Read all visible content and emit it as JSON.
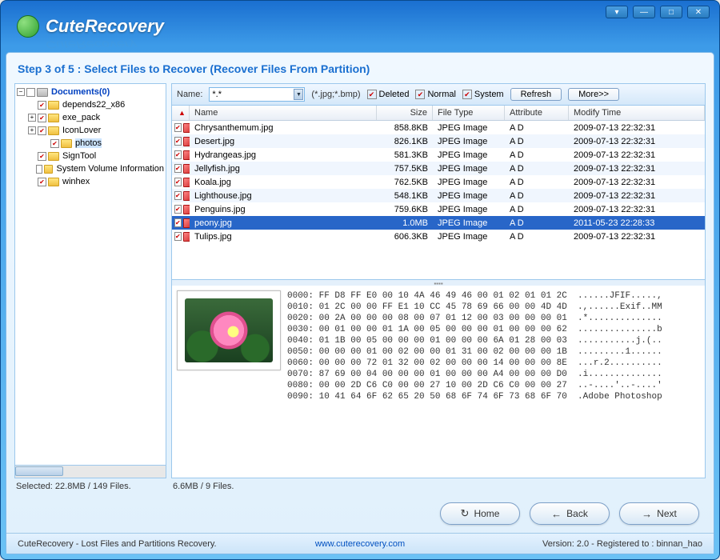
{
  "brand": "CuteRecovery",
  "window": {
    "dropdown": "▾",
    "minimize": "—",
    "maximize": "□",
    "close": "✕"
  },
  "step_title": "Step 3 of 5 : Select Files to Recover (Recover Files From Partition)",
  "tree": {
    "root": {
      "label": "Documents(0)"
    },
    "items": [
      {
        "label": "depends22_x86",
        "expandable": false,
        "checked": true,
        "depth": 1
      },
      {
        "label": "exe_pack",
        "expandable": true,
        "checked": true,
        "depth": 1
      },
      {
        "label": "IconLover",
        "expandable": true,
        "checked": true,
        "depth": 1
      },
      {
        "label": "photos",
        "expandable": false,
        "checked": true,
        "depth": 2,
        "selected": true
      },
      {
        "label": "SignTool",
        "expandable": false,
        "checked": true,
        "depth": 1
      },
      {
        "label": "System Volume Information",
        "expandable": false,
        "checked": false,
        "depth": 1
      },
      {
        "label": "winhex",
        "expandable": false,
        "checked": true,
        "depth": 1
      }
    ]
  },
  "tree_status": "Selected: 22.8MB / 149 Files.",
  "toolbar": {
    "name_label": "Name:",
    "name_value": "*.*",
    "mask_hint": "(*.jpg;*.bmp)",
    "deleted": {
      "label": "Deleted",
      "checked": true
    },
    "normal": {
      "label": "Normal",
      "checked": true
    },
    "system": {
      "label": "System",
      "checked": true
    },
    "refresh": "Refresh",
    "more": "More>>"
  },
  "columns": {
    "name": "Name",
    "size": "Size",
    "ft": "File Type",
    "attr": "Attribute",
    "mt": "Modify Time"
  },
  "files": [
    {
      "name": "Chrysanthemum.jpg",
      "size": "858.8KB",
      "ft": "JPEG Image",
      "attr": "A D",
      "mt": "2009-07-13 22:32:31",
      "checked": true
    },
    {
      "name": "Desert.jpg",
      "size": "826.1KB",
      "ft": "JPEG Image",
      "attr": "A D",
      "mt": "2009-07-13 22:32:31",
      "checked": true
    },
    {
      "name": "Hydrangeas.jpg",
      "size": "581.3KB",
      "ft": "JPEG Image",
      "attr": "A D",
      "mt": "2009-07-13 22:32:31",
      "checked": true
    },
    {
      "name": "Jellyfish.jpg",
      "size": "757.5KB",
      "ft": "JPEG Image",
      "attr": "A D",
      "mt": "2009-07-13 22:32:31",
      "checked": true
    },
    {
      "name": "Koala.jpg",
      "size": "762.5KB",
      "ft": "JPEG Image",
      "attr": "A D",
      "mt": "2009-07-13 22:32:31",
      "checked": true
    },
    {
      "name": "Lighthouse.jpg",
      "size": "548.1KB",
      "ft": "JPEG Image",
      "attr": "A D",
      "mt": "2009-07-13 22:32:31",
      "checked": true
    },
    {
      "name": "Penguins.jpg",
      "size": "759.6KB",
      "ft": "JPEG Image",
      "attr": "A D",
      "mt": "2009-07-13 22:32:31",
      "checked": true
    },
    {
      "name": "peony.jpg",
      "size": "1.0MB",
      "ft": "JPEG Image",
      "attr": "A D",
      "mt": "2011-05-23 22:28:33",
      "checked": true,
      "selected": true
    },
    {
      "name": "Tulips.jpg",
      "size": "606.3KB",
      "ft": "JPEG Image",
      "attr": "A D",
      "mt": "2009-07-13 22:32:31",
      "checked": true
    }
  ],
  "right_status": "6.6MB / 9 Files.",
  "hex": "0000: FF D8 FF E0 00 10 4A 46 49 46 00 01 02 01 01 2C  ......JFIF.....,\n0010: 01 2C 00 00 FF E1 10 CC 45 78 69 66 00 00 4D 4D  .,......Exif..MM\n0020: 00 2A 00 00 00 08 00 07 01 12 00 03 00 00 00 01  .*..............\n0030: 00 01 00 00 01 1A 00 05 00 00 00 01 00 00 00 62  ...............b\n0040: 01 1B 00 05 00 00 00 01 00 00 00 6A 01 28 00 03  ...........j.(..\n0050: 00 00 00 01 00 02 00 00 01 31 00 02 00 00 00 1B  .........1......\n0060: 00 00 00 72 01 32 00 02 00 00 00 14 00 00 00 8E  ...r.2..........\n0070: 87 69 00 04 00 00 00 01 00 00 00 A4 00 00 00 D0  .i..............\n0080: 00 00 2D C6 C0 00 00 27 10 00 2D C6 C0 00 00 27  ..-....'..-....'\n0090: 10 41 64 6F 62 65 20 50 68 6F 74 6F 73 68 6F 70  .Adobe Photoshop",
  "buttons": {
    "home": "Home",
    "back": "Back",
    "next": "Next"
  },
  "footer": {
    "tagline": "CuteRecovery - Lost Files and Partitions Recovery.",
    "url": "www.cuterecovery.com",
    "version": "Version: 2.0 - Registered to : binnan_hao"
  }
}
